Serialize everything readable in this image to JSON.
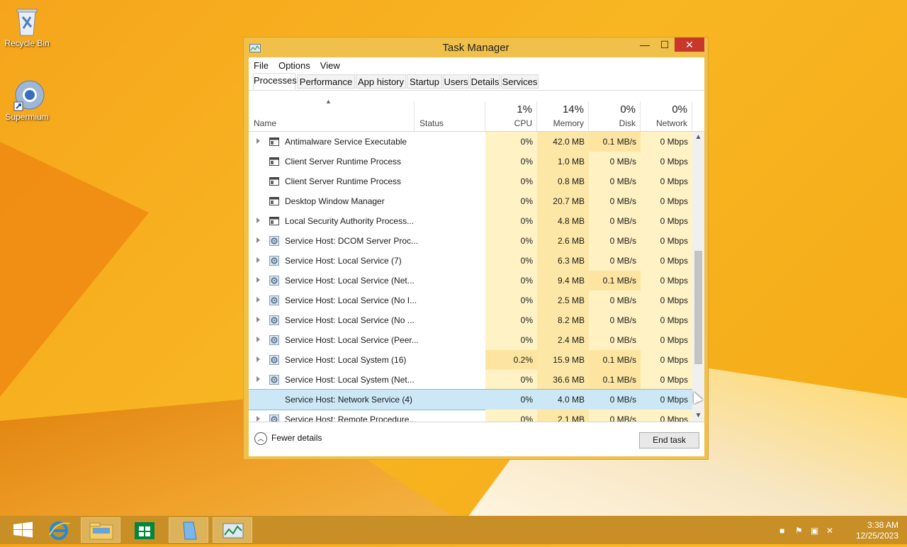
{
  "desktop": {
    "icons": [
      {
        "label": "Recycle Bin"
      },
      {
        "label": "Supermium"
      }
    ]
  },
  "window": {
    "title": "Task Manager",
    "controls": {
      "minimize": "—",
      "maximize": "☐",
      "close": "✕"
    }
  },
  "menu": [
    "File",
    "Options",
    "View"
  ],
  "tabs": [
    "Processes",
    "Performance",
    "App history",
    "Startup",
    "Users",
    "Details",
    "Services"
  ],
  "active_tab": "Processes",
  "columns": {
    "name": "Name",
    "status": "Status",
    "cpu": {
      "pct": "1%",
      "label": "CPU"
    },
    "memory": {
      "pct": "14%",
      "label": "Memory"
    },
    "disk": {
      "pct": "0%",
      "label": "Disk"
    },
    "network": {
      "pct": "0%",
      "label": "Network"
    }
  },
  "rows": [
    {
      "name": "Antimalware Service Executable",
      "expand": true,
      "icon": "window-icon",
      "cpu": "0%",
      "mem": "42.0 MB",
      "disk": "0.1 MB/s",
      "net": "0 Mbps",
      "disk_hot": true
    },
    {
      "name": "Client Server Runtime Process",
      "expand": false,
      "icon": "window-icon",
      "cpu": "0%",
      "mem": "1.0 MB",
      "disk": "0 MB/s",
      "net": "0 Mbps"
    },
    {
      "name": "Client Server Runtime Process",
      "expand": false,
      "icon": "window-icon",
      "cpu": "0%",
      "mem": "0.8 MB",
      "disk": "0 MB/s",
      "net": "0 Mbps"
    },
    {
      "name": "Desktop Window Manager",
      "expand": false,
      "icon": "window-icon",
      "cpu": "0%",
      "mem": "20.7 MB",
      "disk": "0 MB/s",
      "net": "0 Mbps"
    },
    {
      "name": "Local Security Authority Process...",
      "expand": true,
      "icon": "window-icon",
      "cpu": "0%",
      "mem": "4.8 MB",
      "disk": "0 MB/s",
      "net": "0 Mbps"
    },
    {
      "name": "Service Host: DCOM Server Proc...",
      "expand": true,
      "icon": "gear-icon",
      "cpu": "0%",
      "mem": "2.6 MB",
      "disk": "0 MB/s",
      "net": "0 Mbps"
    },
    {
      "name": "Service Host: Local Service (7)",
      "expand": true,
      "icon": "gear-icon",
      "cpu": "0%",
      "mem": "6.3 MB",
      "disk": "0 MB/s",
      "net": "0 Mbps"
    },
    {
      "name": "Service Host: Local Service (Net...",
      "expand": true,
      "icon": "gear-icon",
      "cpu": "0%",
      "mem": "9.4 MB",
      "disk": "0.1 MB/s",
      "net": "0 Mbps",
      "disk_hot": true
    },
    {
      "name": "Service Host: Local Service (No I...",
      "expand": true,
      "icon": "gear-icon",
      "cpu": "0%",
      "mem": "2.5 MB",
      "disk": "0 MB/s",
      "net": "0 Mbps"
    },
    {
      "name": "Service Host: Local Service (No ...",
      "expand": true,
      "icon": "gear-icon",
      "cpu": "0%",
      "mem": "8.2 MB",
      "disk": "0 MB/s",
      "net": "0 Mbps"
    },
    {
      "name": "Service Host: Local Service (Peer...",
      "expand": true,
      "icon": "gear-icon",
      "cpu": "0%",
      "mem": "2.4 MB",
      "disk": "0 MB/s",
      "net": "0 Mbps"
    },
    {
      "name": "Service Host: Local System (16)",
      "expand": true,
      "icon": "gear-icon",
      "cpu": "0.2%",
      "mem": "15.9 MB",
      "disk": "0.1 MB/s",
      "net": "0 Mbps",
      "cpu_hot": true,
      "disk_hot": true
    },
    {
      "name": "Service Host: Local System (Net...",
      "expand": true,
      "icon": "gear-icon",
      "cpu": "0%",
      "mem": "36.6 MB",
      "disk": "0.1 MB/s",
      "net": "0 Mbps",
      "disk_hot": true
    },
    {
      "name": "Service Host: Network Service (4)",
      "expand": true,
      "icon": "gear-icon",
      "cpu": "0%",
      "mem": "4.0 MB",
      "disk": "0 MB/s",
      "net": "0 Mbps",
      "selected": true
    },
    {
      "name": "Service Host: Remote Procedure...",
      "expand": true,
      "icon": "gear-icon",
      "cpu": "0%",
      "mem": "2.1 MB",
      "disk": "0 MB/s",
      "net": "0 Mbps"
    }
  ],
  "footer": {
    "fewer_details": "Fewer details",
    "end_task": "End task"
  },
  "taskbar": {
    "time": "3:38 AM",
    "date": "12/25/2023"
  }
}
